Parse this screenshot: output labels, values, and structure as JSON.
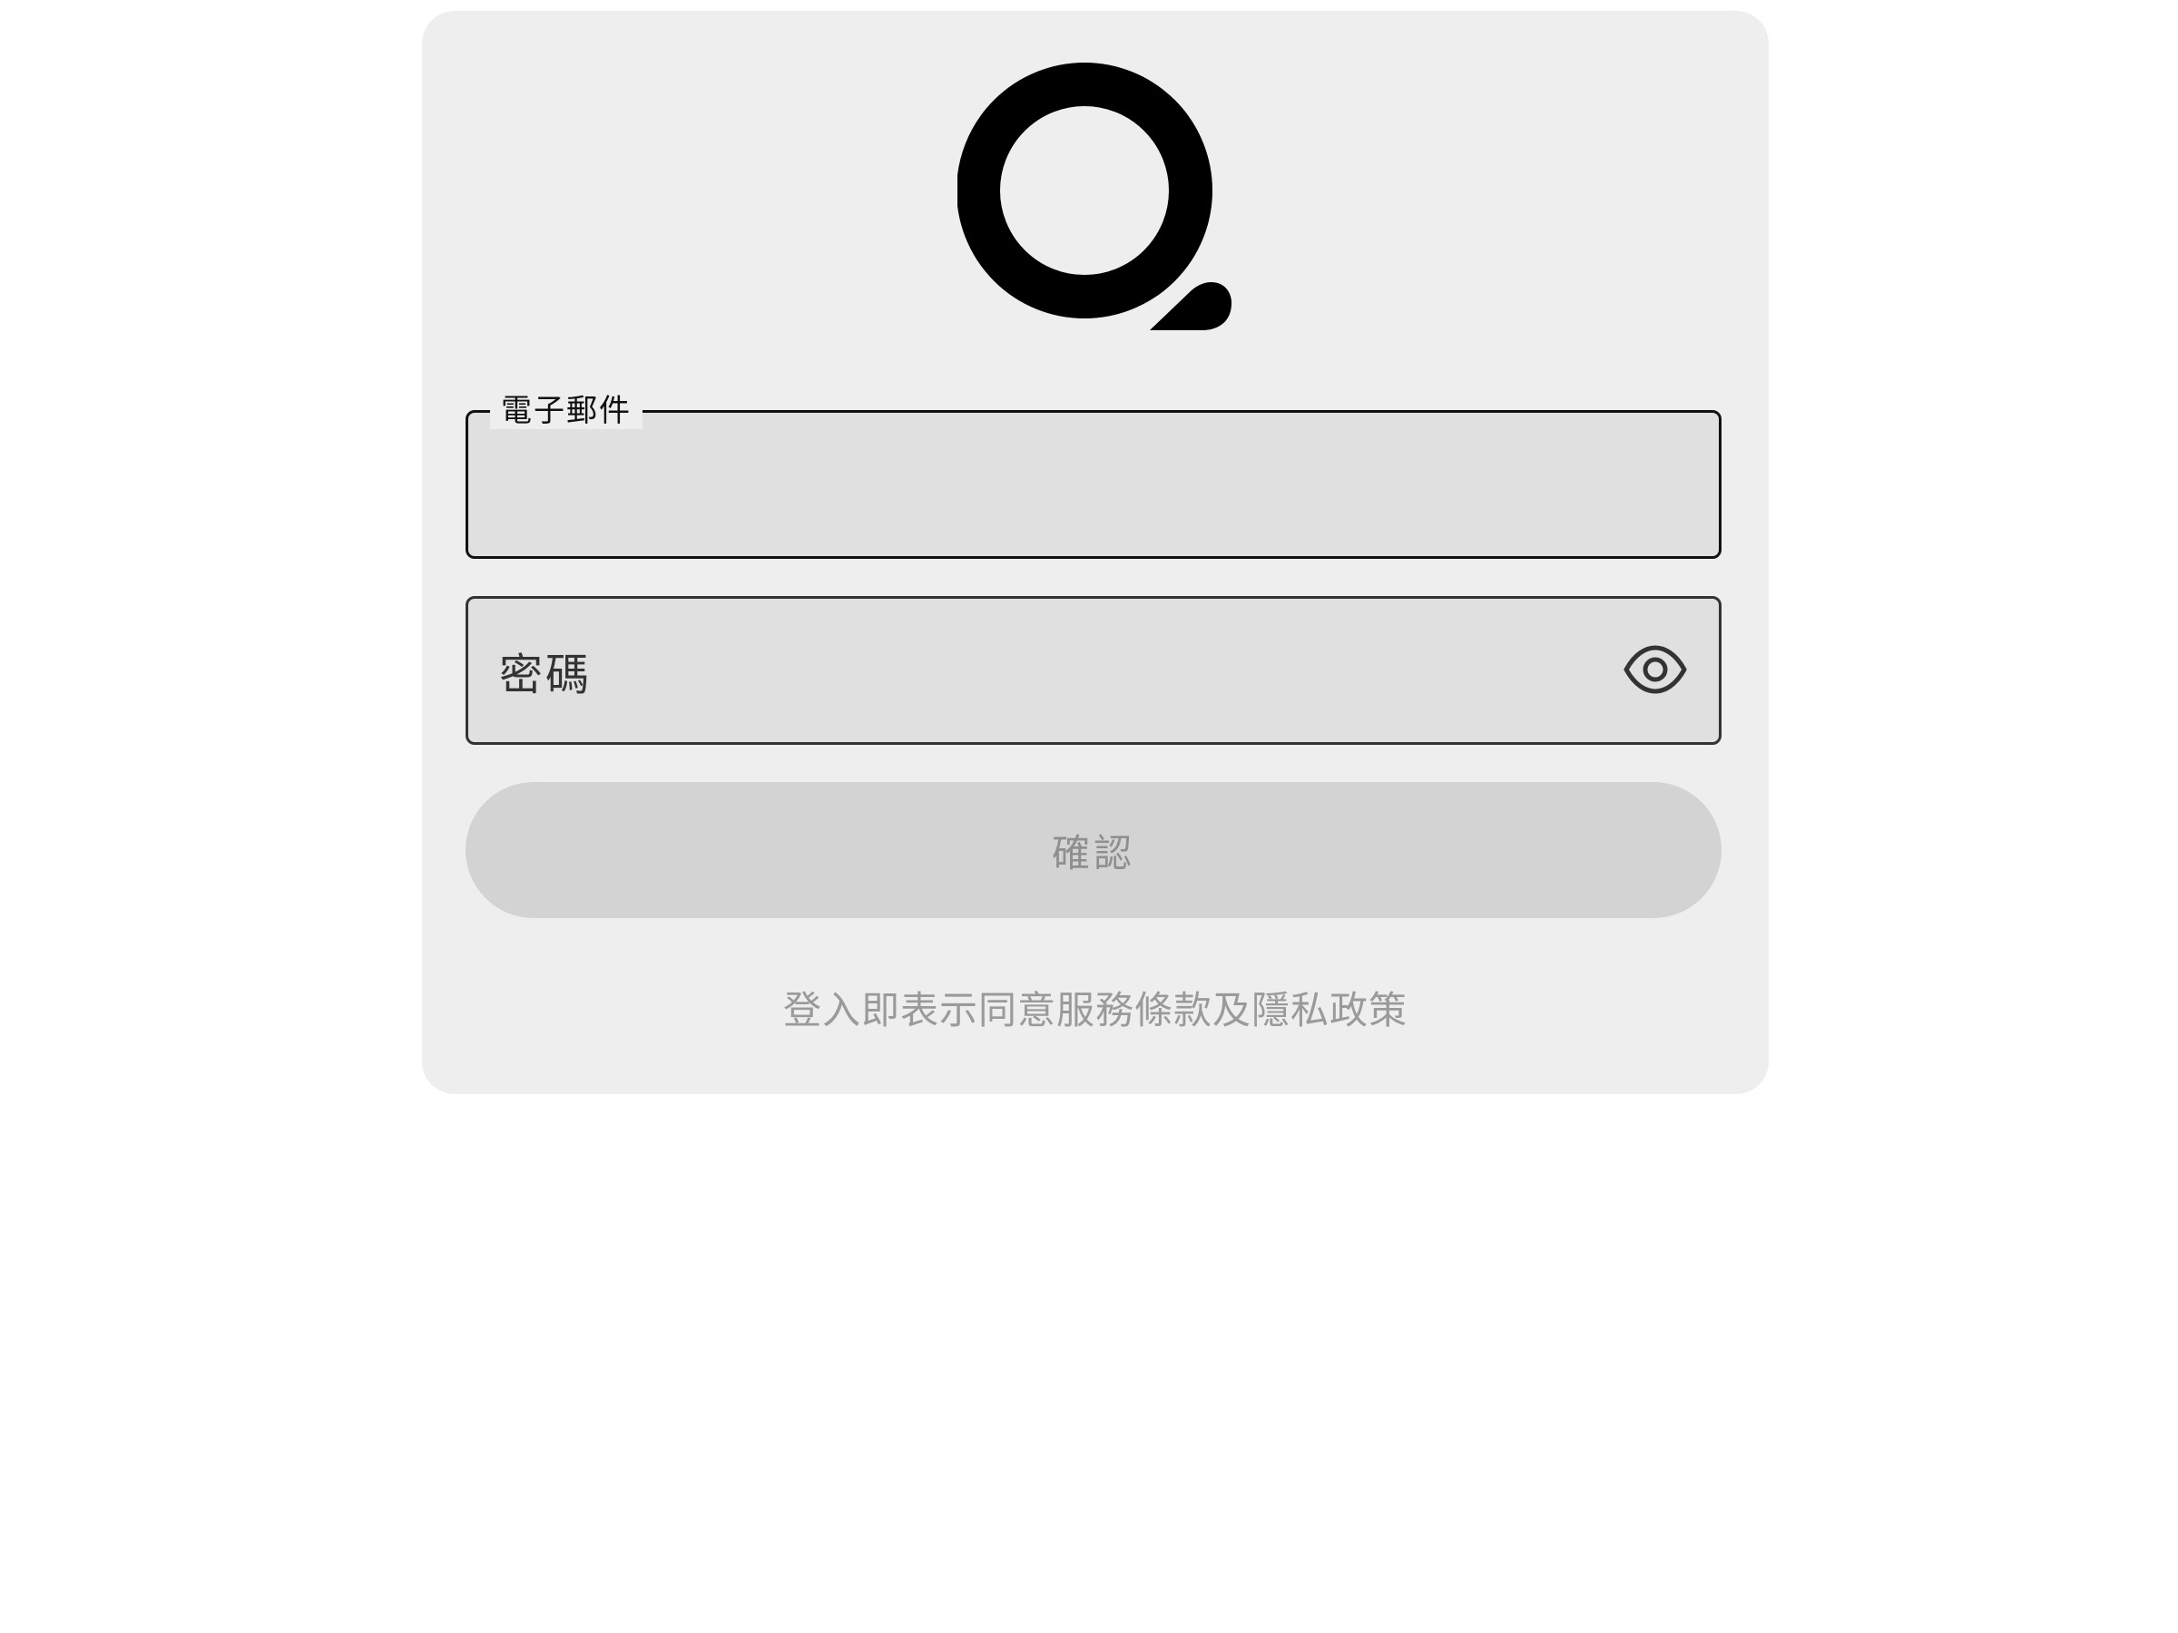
{
  "logo": {
    "icon": "q-logo-icon",
    "color": "#000000"
  },
  "form": {
    "email": {
      "label": "電子郵件",
      "value": ""
    },
    "password": {
      "label": "密碼",
      "value": "",
      "toggle_icon": "eye-icon"
    },
    "submit_label": "確認",
    "terms_text": "登入即表示同意服務條款及隱私政策"
  },
  "colors": {
    "card_background": "#eeeeee",
    "field_background": "#e0e0e0",
    "button_disabled": "#d3d3d3",
    "button_text_disabled": "#8f8f8f",
    "muted_text": "#9a9a9a"
  }
}
